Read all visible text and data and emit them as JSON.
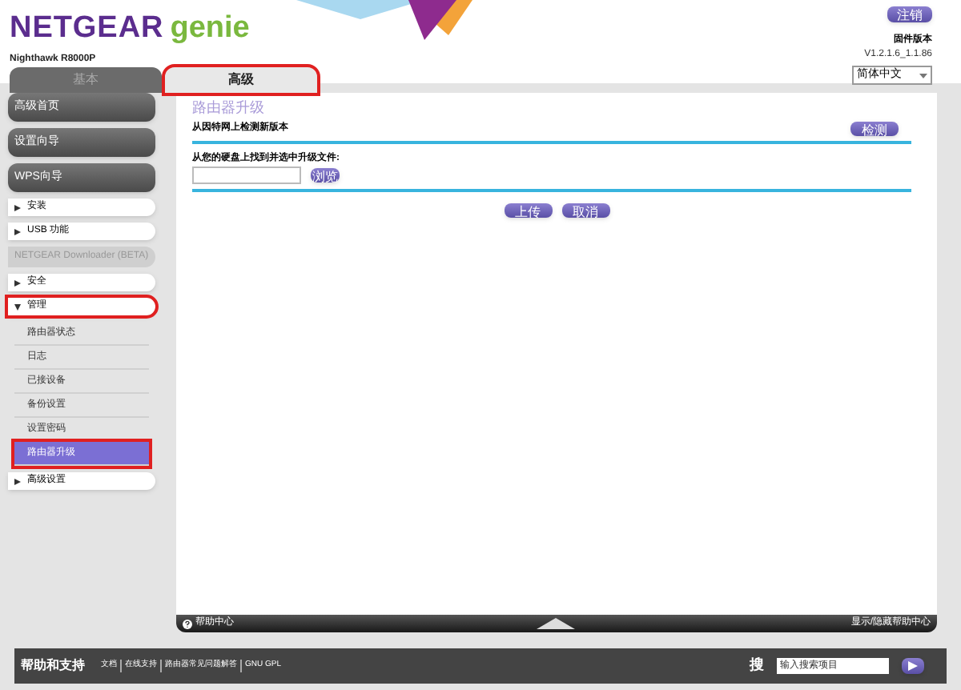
{
  "header": {
    "logo_brand": "NETGEAR",
    "logo_product": "genie",
    "model": "Nighthawk R8000P",
    "logout_button": "注销",
    "firmware_label": "固件版本",
    "firmware_version": "V1.2.1.6_1.1.86",
    "language": "简体中文"
  },
  "tabs": [
    {
      "label": "基本",
      "selected": false,
      "highlighted": false
    },
    {
      "label": "高级",
      "selected": true,
      "highlighted": true
    }
  ],
  "sidebar": {
    "items": [
      {
        "kind": "main",
        "label": "高级首页"
      },
      {
        "kind": "main",
        "label": "设置向导"
      },
      {
        "kind": "main",
        "label": "WPS向导"
      },
      {
        "kind": "section",
        "label": "安装",
        "expanded": false,
        "highlighted": false
      },
      {
        "kind": "section",
        "label": "USB 功能",
        "expanded": false,
        "highlighted": false
      },
      {
        "kind": "disabled",
        "label": "NETGEAR Downloader (BETA)"
      },
      {
        "kind": "section",
        "label": "安全",
        "expanded": false,
        "highlighted": false
      },
      {
        "kind": "section",
        "label": "管理",
        "expanded": true,
        "highlighted": true,
        "children": [
          {
            "label": "路由器状态",
            "selected": false
          },
          {
            "label": "日志",
            "selected": false
          },
          {
            "label": "已接设备",
            "selected": false
          },
          {
            "label": "备份设置",
            "selected": false
          },
          {
            "label": "设置密码",
            "selected": false
          },
          {
            "label": "路由器升级",
            "selected": true
          }
        ]
      },
      {
        "kind": "section",
        "label": "高级设置",
        "expanded": false,
        "highlighted": false
      }
    ]
  },
  "content": {
    "title": "路由器升级",
    "check_label": "从因特网上检测新版本",
    "check_button": "检测",
    "file_label": "从您的硬盘上找到并选中升级文件:",
    "browse_button": "浏览",
    "upload_button": "上传",
    "cancel_button": "取消"
  },
  "help_bar": {
    "left": "帮助中心",
    "right": "显示/隐藏帮助中心"
  },
  "footer": {
    "title": "帮助和支持",
    "links": [
      "文档",
      "在线支持",
      "路由器常见问题解答",
      "GNU GPL"
    ],
    "search_label": "搜",
    "search_placeholder": "输入搜索项目"
  }
}
